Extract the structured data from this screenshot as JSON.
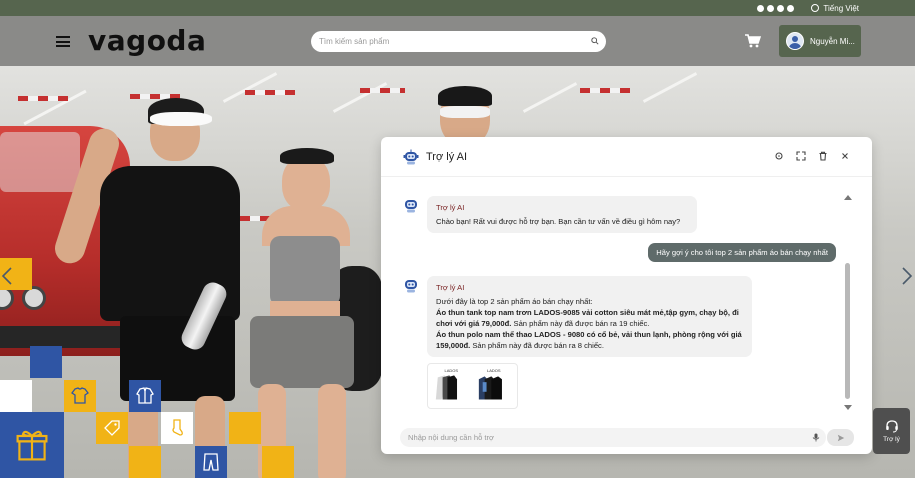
{
  "topbar": {
    "social_icons": [
      "facebook-icon",
      "instagram-icon",
      "pinterest-icon",
      "youtube-icon"
    ],
    "language": "Tiếng Việt"
  },
  "header": {
    "logo": "vagoda",
    "search_placeholder": "Tìm kiếm sản phẩm",
    "user_name": "Nguyễn Mi..."
  },
  "colors": {
    "brand_green": "#56654e",
    "header_gray": "#8a8a88",
    "user_bubble": "#5f6b6a",
    "accent_yellow": "#f1b316",
    "accent_blue": "#2f55a4",
    "bot_name": "#7a2424"
  },
  "chat": {
    "title": "Trợ lý AI",
    "messages": [
      {
        "role": "bot",
        "name": "Trợ lý AI",
        "text": "Chào bạn! Rất vui được hỗ trợ bạn. Bạn cần tư vấn về điều gì hôm nay?"
      },
      {
        "role": "user",
        "text": "Hãy gợi ý cho tôi top 2 sản phẩm áo bán chạy nhất"
      },
      {
        "role": "bot",
        "name": "Trợ lý AI",
        "intro": "Dưới đây là top 2 sản phẩm áo bán chạy nhất:",
        "p1_bold": "Áo thun tank top nam trơn LADOS-9085 vải cotton siêu mát mẻ,tập gym, chạy bộ, đi chơi với giá 79,000đ.",
        "p1_rest": " Sản phẩm này đã được bán ra 19 chiếc.",
        "p2_bold": "Áo thun polo nam thể thao LADOS - 9080 có cổ bẻ, vải thun lạnh, phòng rộng với giá 159,000đ.",
        "p2_rest": " Sản phẩm này đã được bán ra 8 chiếc."
      }
    ],
    "product_labels": [
      "LADOS",
      "LADOS"
    ],
    "input_placeholder": "Nhập nội dung cần hỗ trợ"
  },
  "support_button": {
    "label": "Trợ lý"
  }
}
